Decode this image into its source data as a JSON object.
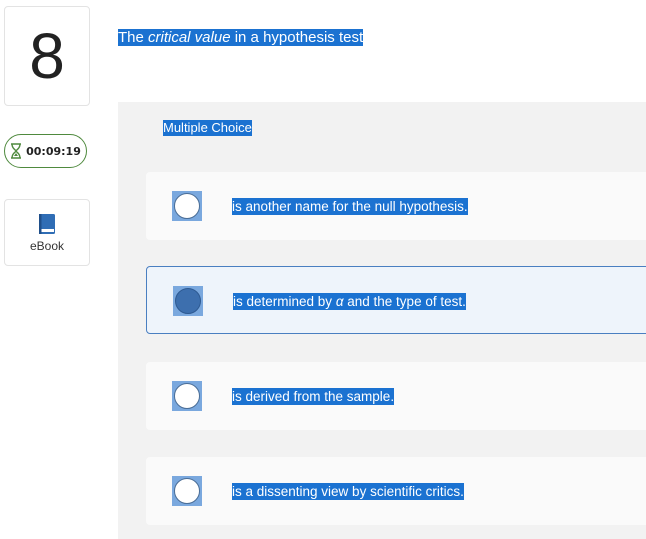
{
  "question": {
    "number": "8",
    "timer": "00:09:19",
    "ebook_label": "eBook",
    "prompt_before": "The ",
    "prompt_term": "critical value",
    "prompt_after": " in a hypothesis test "
  },
  "answers": {
    "type_label": "Multiple Choice",
    "options": [
      {
        "text": "is another name for the null hypothesis. ",
        "selected": false
      },
      {
        "text_before": "is determined by ",
        "symbol": "α",
        "text_after": " and the type of test. ",
        "selected": true
      },
      {
        "text": "is derived from the sample. ",
        "selected": false
      },
      {
        "text": "is a dissenting view by scientific critics.",
        "selected": false
      }
    ]
  },
  "colors": {
    "selection_highlight": "#1b72d1",
    "timer_border": "#4f8a3e",
    "selected_radio": "#3d6fae"
  },
  "icons": [
    "hourglass-icon",
    "book-icon"
  ]
}
